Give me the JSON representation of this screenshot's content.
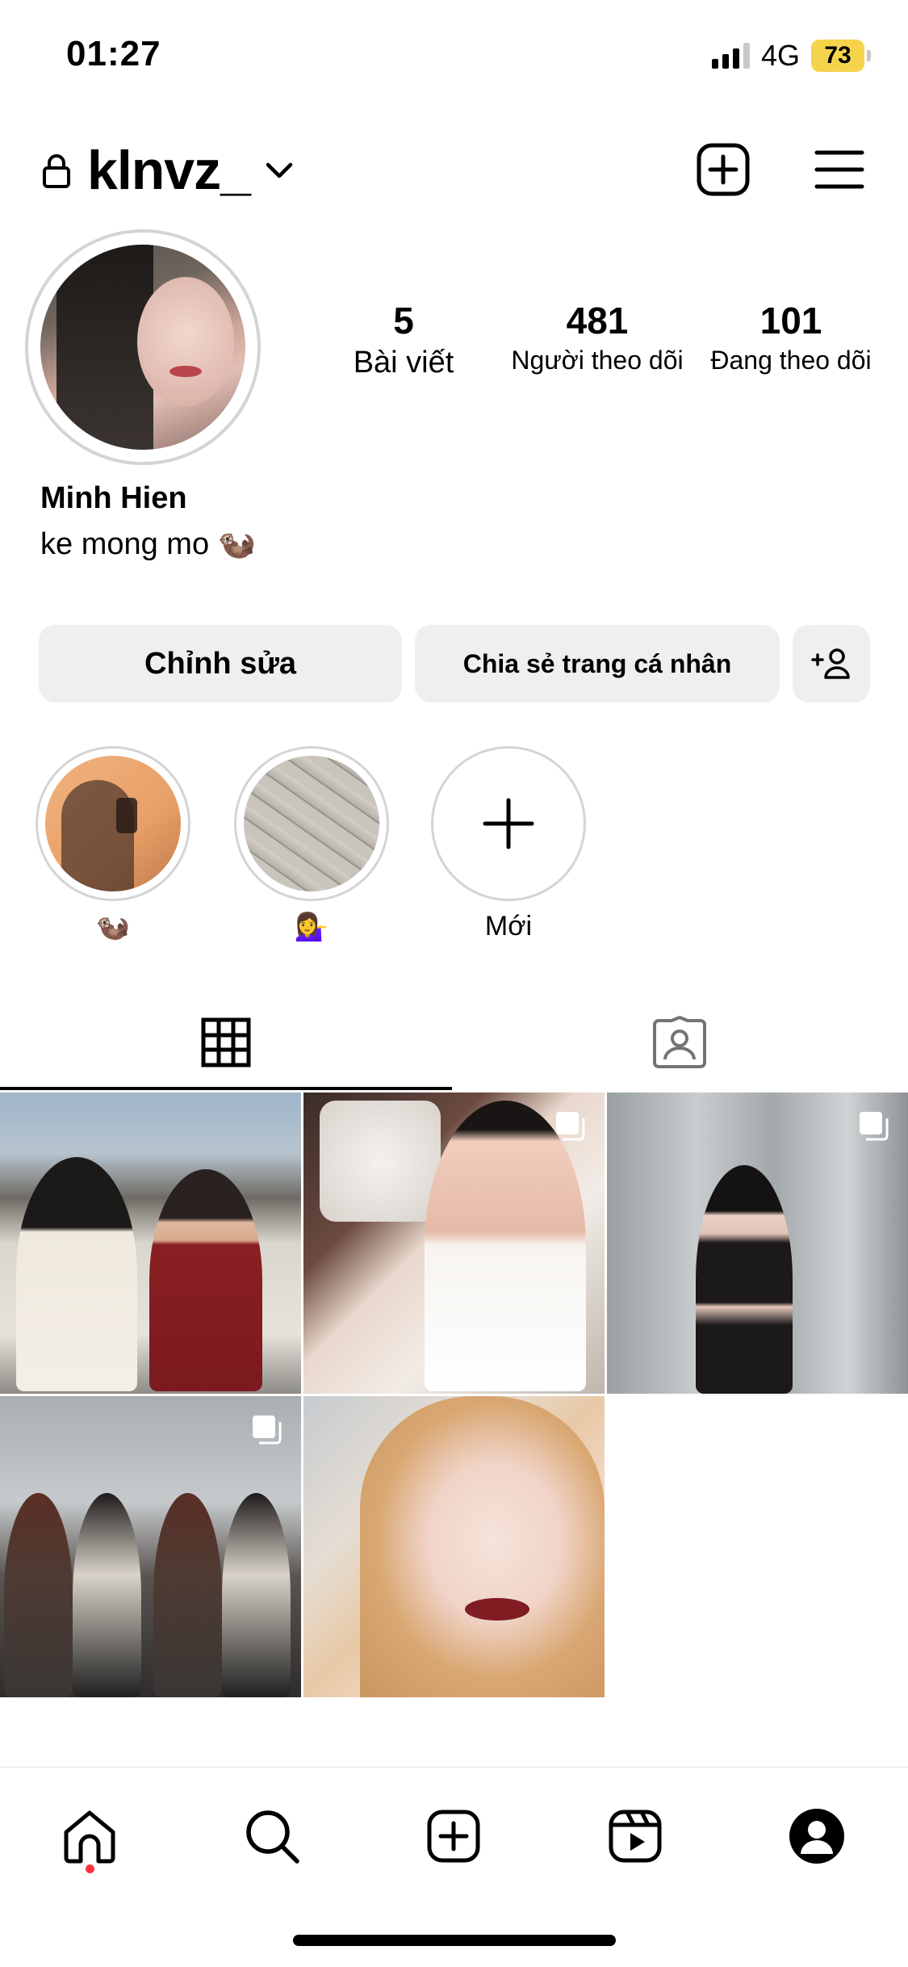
{
  "status_bar": {
    "time": "01:27",
    "network": "4G",
    "battery": "73"
  },
  "header": {
    "username": "klnvz_"
  },
  "profile": {
    "name": "Minh Hien",
    "bio": "ke mong mo 🦦",
    "stats": [
      {
        "value": "5",
        "label": "Bài viết"
      },
      {
        "value": "481",
        "label": "Người theo dõi"
      },
      {
        "value": "101",
        "label": "Đang theo dõi"
      }
    ]
  },
  "actions": {
    "edit_label": "Chỉnh sửa",
    "share_label": "Chia sẻ trang cá nhân"
  },
  "highlights": [
    {
      "label": "🦦"
    },
    {
      "label": "💁‍♀️"
    },
    {
      "label": "Mới"
    }
  ],
  "colors": {
    "accent_notification": "#ff3040",
    "button_bg": "#efefef",
    "battery_low_power": "#f5d44b"
  },
  "icons": {
    "header": [
      "lock-icon",
      "chevron-down-icon",
      "create-post-icon",
      "menu-icon"
    ],
    "tabs": [
      "grid-icon",
      "tagged-icon"
    ],
    "nav": [
      "home-icon",
      "search-icon",
      "create-icon",
      "reels-icon",
      "profile-icon"
    ]
  }
}
